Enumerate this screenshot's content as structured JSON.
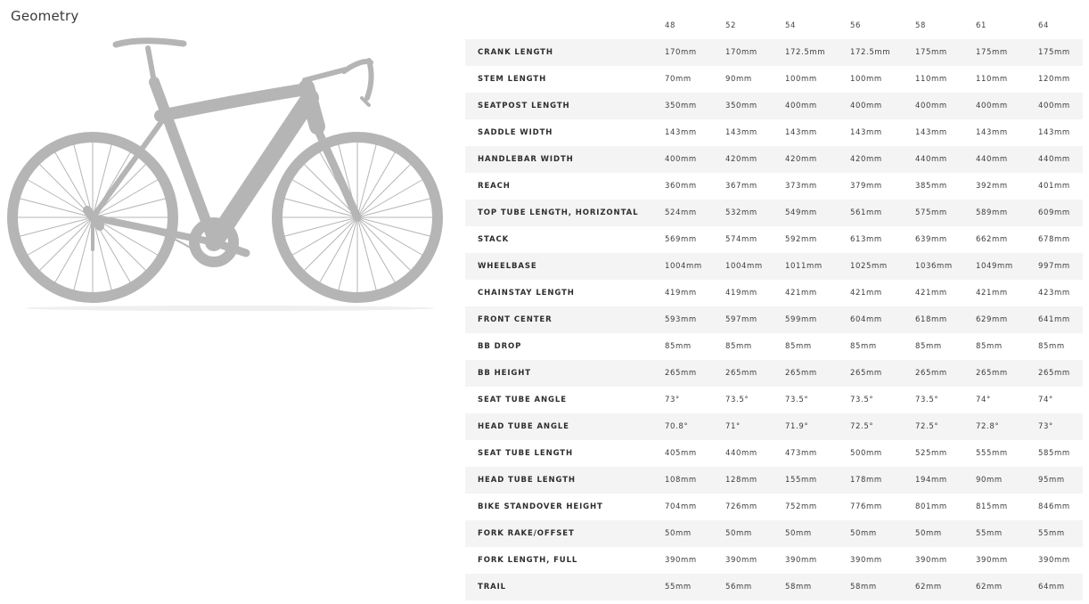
{
  "page": {
    "title": "Geometry"
  },
  "bike_image": {
    "icon": "road-bike-silhouette-icon",
    "color": "#b5b5b5"
  },
  "table": {
    "sizes": [
      "48",
      "52",
      "54",
      "56",
      "58",
      "61",
      "64"
    ],
    "rows": [
      {
        "label": "CRANK LENGTH",
        "values": [
          "170mm",
          "170mm",
          "172.5mm",
          "172.5mm",
          "175mm",
          "175mm",
          "175mm"
        ]
      },
      {
        "label": "STEM LENGTH",
        "values": [
          "70mm",
          "90mm",
          "100mm",
          "100mm",
          "110mm",
          "110mm",
          "120mm"
        ]
      },
      {
        "label": "SEATPOST LENGTH",
        "values": [
          "350mm",
          "350mm",
          "400mm",
          "400mm",
          "400mm",
          "400mm",
          "400mm"
        ]
      },
      {
        "label": "SADDLE WIDTH",
        "values": [
          "143mm",
          "143mm",
          "143mm",
          "143mm",
          "143mm",
          "143mm",
          "143mm"
        ]
      },
      {
        "label": "HANDLEBAR WIDTH",
        "values": [
          "400mm",
          "420mm",
          "420mm",
          "420mm",
          "440mm",
          "440mm",
          "440mm"
        ]
      },
      {
        "label": "REACH",
        "values": [
          "360mm",
          "367mm",
          "373mm",
          "379mm",
          "385mm",
          "392mm",
          "401mm"
        ]
      },
      {
        "label": "TOP TUBE LENGTH, HORIZONTAL",
        "values": [
          "524mm",
          "532mm",
          "549mm",
          "561mm",
          "575mm",
          "589mm",
          "609mm"
        ]
      },
      {
        "label": "STACK",
        "values": [
          "569mm",
          "574mm",
          "592mm",
          "613mm",
          "639mm",
          "662mm",
          "678mm"
        ]
      },
      {
        "label": "WHEELBASE",
        "values": [
          "1004mm",
          "1004mm",
          "1011mm",
          "1025mm",
          "1036mm",
          "1049mm",
          "997mm"
        ]
      },
      {
        "label": "CHAINSTAY LENGTH",
        "values": [
          "419mm",
          "419mm",
          "421mm",
          "421mm",
          "421mm",
          "421mm",
          "423mm"
        ]
      },
      {
        "label": "FRONT CENTER",
        "values": [
          "593mm",
          "597mm",
          "599mm",
          "604mm",
          "618mm",
          "629mm",
          "641mm"
        ]
      },
      {
        "label": "BB DROP",
        "values": [
          "85mm",
          "85mm",
          "85mm",
          "85mm",
          "85mm",
          "85mm",
          "85mm"
        ]
      },
      {
        "label": "BB HEIGHT",
        "values": [
          "265mm",
          "265mm",
          "265mm",
          "265mm",
          "265mm",
          "265mm",
          "265mm"
        ]
      },
      {
        "label": "SEAT TUBE ANGLE",
        "values": [
          "73°",
          "73.5°",
          "73.5°",
          "73.5°",
          "73.5°",
          "74°",
          "74°"
        ]
      },
      {
        "label": "HEAD TUBE ANGLE",
        "values": [
          "70.8°",
          "71°",
          "71.9°",
          "72.5°",
          "72.5°",
          "72.8°",
          "73°"
        ]
      },
      {
        "label": "SEAT TUBE LENGTH",
        "values": [
          "405mm",
          "440mm",
          "473mm",
          "500mm",
          "525mm",
          "555mm",
          "585mm"
        ]
      },
      {
        "label": "HEAD TUBE LENGTH",
        "values": [
          "108mm",
          "128mm",
          "155mm",
          "178mm",
          "194mm",
          "90mm",
          "95mm"
        ]
      },
      {
        "label": "BIKE STANDOVER HEIGHT",
        "values": [
          "704mm",
          "726mm",
          "752mm",
          "776mm",
          "801mm",
          "815mm",
          "846mm"
        ]
      },
      {
        "label": "FORK RAKE/OFFSET",
        "values": [
          "50mm",
          "50mm",
          "50mm",
          "50mm",
          "50mm",
          "55mm",
          "55mm"
        ]
      },
      {
        "label": "FORK LENGTH, FULL",
        "values": [
          "390mm",
          "390mm",
          "390mm",
          "390mm",
          "390mm",
          "390mm",
          "390mm"
        ]
      },
      {
        "label": "TRAIL",
        "values": [
          "55mm",
          "56mm",
          "58mm",
          "58mm",
          "62mm",
          "62mm",
          "64mm"
        ]
      }
    ]
  }
}
